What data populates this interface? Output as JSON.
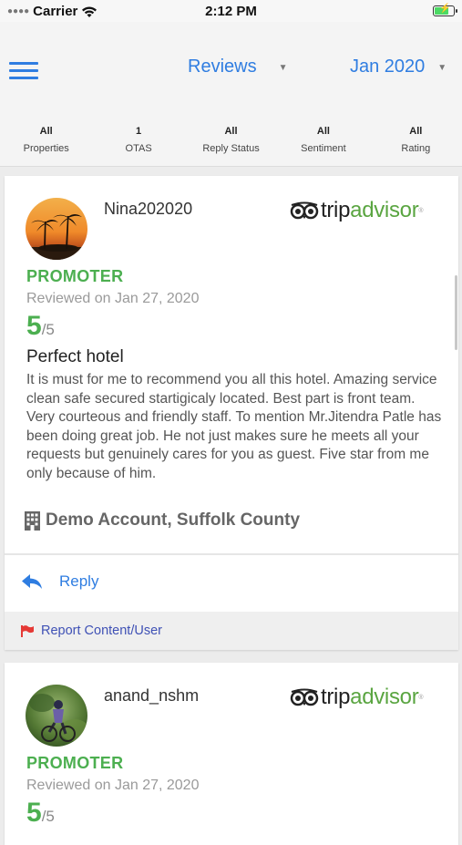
{
  "status_bar": {
    "carrier": "Carrier",
    "time": "2:12 PM",
    "battery_level": 0.8
  },
  "nav": {
    "reviews_label": "Reviews",
    "month_label": "Jan 2020",
    "accent_color": "#2f7de1"
  },
  "filters": [
    {
      "value": "All",
      "label": "Properties"
    },
    {
      "value": "1",
      "label": "OTAS"
    },
    {
      "value": "All",
      "label": "Reply Status"
    },
    {
      "value": "All",
      "label": "Sentiment"
    },
    {
      "value": "All",
      "label": "Rating"
    }
  ],
  "reviews": [
    {
      "username": "Nina202020",
      "source": {
        "trip": "trip",
        "advisor": "advisor"
      },
      "sentiment": "PROMOTER",
      "reviewed_on": "Reviewed on Jan 27, 2020",
      "rating": "5",
      "rating_max": "/5",
      "title": "Perfect hotel",
      "body": "It is must for me to recommend you all this hotel. Amazing service clean safe secured startigicaly located. Best part is front team. Very courteous and friendly staff. To mention Mr.Jitendra Patle has been doing great job. He not just makes sure he meets all your requests but genuinely cares for you as guest. Five star from me only because of him.",
      "property": "Demo Account, Suffolk County",
      "reply_label": "Reply",
      "report_label": "Report Content/User"
    },
    {
      "username": "anand_nshm",
      "source": {
        "trip": "trip",
        "advisor": "advisor"
      },
      "sentiment": "PROMOTER",
      "reviewed_on": "Reviewed on Jan 27, 2020",
      "rating": "5",
      "rating_max": "/5"
    }
  ],
  "colors": {
    "promoter_green": "#4caf50",
    "tripadvisor_green": "#5aa541",
    "report_blue": "#3f51b5",
    "flag_red": "#e53935"
  }
}
